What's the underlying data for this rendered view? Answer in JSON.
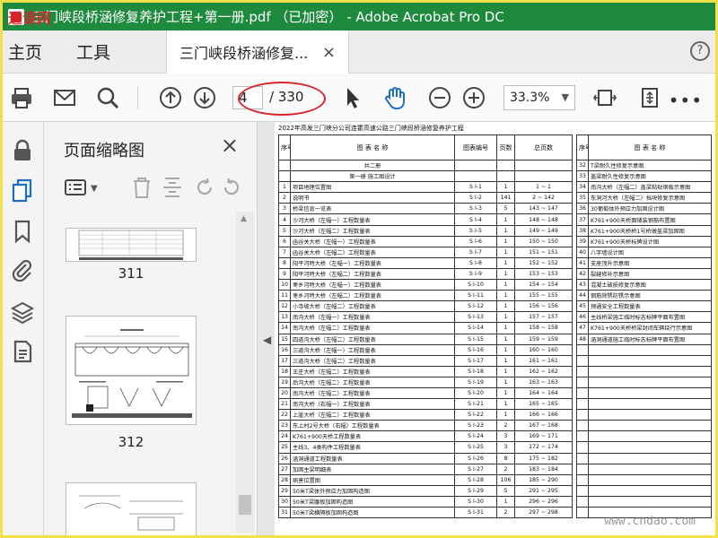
{
  "window": {
    "title": "三门峡段桥涵修复养护工程+第一册.pdf （已加密） - Adobe Acrobat Pro DC",
    "watermark_topleft": "进课网"
  },
  "menu": {
    "items": [
      "主页",
      "工具"
    ],
    "tab_label": "三门峡段桥涵修复...",
    "tab_close": "×",
    "help": "?"
  },
  "toolbar": {
    "current_page": "4",
    "total_pages": "/ 330",
    "zoom": "33.3%",
    "more": "•••"
  },
  "thumbnails": {
    "title": "页面缩略图",
    "close": "×",
    "pages": [
      "311",
      "312"
    ]
  },
  "document": {
    "header": "2022年高发三门峡分公司连霍高速公路三门峡段桥涵修复养护工程",
    "columns": {
      "seq": "序号",
      "name": "图 表 名 称",
      "code": "图表编号",
      "pages": "页数",
      "total": "总页数"
    },
    "left_rows": [
      [
        "",
        "共二册",
        "",
        "",
        ""
      ],
      [
        "",
        "第一册  施工图设计",
        "",
        "",
        ""
      ],
      [
        "1",
        "项目地理位置图",
        "S Ⅰ-1",
        "1",
        "1 ~ 1"
      ],
      [
        "2",
        "说明书",
        "S Ⅰ-2",
        "141",
        "2 ~ 142"
      ],
      [
        "3",
        "桥梁信息一览表",
        "S Ⅰ-3",
        "5",
        "143 ~ 147"
      ],
      [
        "4",
        "沙河大桥（左幅一）工程数量表",
        "S Ⅰ-4",
        "1",
        "148 ~ 148"
      ],
      [
        "5",
        "沙河大桥（左幅二）工程数量表",
        "S Ⅰ-5",
        "1",
        "149 ~ 149"
      ],
      [
        "6",
        "函谷关大桥（左幅一）工程数量表",
        "S Ⅰ-6",
        "1",
        "150 ~ 150"
      ],
      [
        "7",
        "函谷关大桥（左幅二）工程数量表",
        "S Ⅰ-7",
        "1",
        "151 ~ 151"
      ],
      [
        "8",
        "阳平河特大桥（左幅一）工程数量表",
        "S Ⅰ-8",
        "1",
        "152 ~ 152"
      ],
      [
        "9",
        "阳平河特大桥（左幅二）工程数量表",
        "S Ⅰ-9",
        "1",
        "153 ~ 153"
      ],
      [
        "10",
        "枣乡河特大桥（左幅一）工程数量表",
        "S Ⅰ-10",
        "1",
        "154 ~ 154"
      ],
      [
        "11",
        "枣乡河特大桥（左幅二）工程数量表",
        "S Ⅰ-11",
        "1",
        "155 ~ 155"
      ],
      [
        "12",
        "小寺坡大桥（左幅二）工程数量表",
        "S Ⅰ-12",
        "1",
        "156 ~ 156"
      ],
      [
        "13",
        "南沟大桥（左幅一）工程数量表",
        "S Ⅰ-13",
        "1",
        "157 ~ 157"
      ],
      [
        "14",
        "南沟大桥（左幅二）工程数量表",
        "S Ⅰ-14",
        "1",
        "158 ~ 158"
      ],
      [
        "15",
        "四道沟大桥（左幅二）工程数量表",
        "S Ⅰ-15",
        "1",
        "159 ~ 159"
      ],
      [
        "16",
        "三道沟大桥（左幅一）工程数量表",
        "S Ⅰ-16",
        "1",
        "160 ~ 160"
      ],
      [
        "17",
        "三道沟大桥（左幅二）工程数量表",
        "S Ⅰ-17",
        "1",
        "161 ~ 161"
      ],
      [
        "18",
        "王庄大桥（左幅二）工程数量表",
        "S Ⅰ-18",
        "1",
        "162 ~ 162"
      ],
      [
        "19",
        "后沟大桥（左幅二）工程数量表",
        "S Ⅰ-19",
        "1",
        "163 ~ 163"
      ],
      [
        "20",
        "南沟大桥（左幅二）工程数量表",
        "S Ⅰ-20",
        "1",
        "164 ~ 164"
      ],
      [
        "21",
        "南沟大桥（右幅一）工程数量表",
        "S Ⅰ-21",
        "1",
        "165 ~ 165"
      ],
      [
        "22",
        "上崖大桥（左幅二）工程数量表",
        "S Ⅰ-22",
        "1",
        "166 ~ 166"
      ],
      [
        "23",
        "东上村2号大桥（右幅）工程数量表",
        "S Ⅰ-23",
        "2",
        "167 ~ 168"
      ],
      [
        "24",
        "K761+900天桥工程数量表",
        "S Ⅰ-24",
        "3",
        "169 ~ 171"
      ],
      [
        "25",
        "主线3、4类构件工程数量表",
        "S Ⅰ-25",
        "3",
        "172 ~ 174"
      ],
      [
        "26",
        "涵洞通道工程数量表",
        "S Ⅰ-26",
        "8",
        "175 ~ 182"
      ],
      [
        "27",
        "加固主梁明细表",
        "S Ⅰ-27",
        "2",
        "183 ~ 184"
      ],
      [
        "28",
        "病害位置图",
        "S Ⅰ-28",
        "106",
        "185 ~ 290"
      ],
      [
        "29",
        "50米T梁体外预应力加固构造图",
        "S Ⅰ-29",
        "5",
        "291 ~ 295"
      ],
      [
        "30",
        "50米T梁腹板加固构造图",
        "S Ⅰ-30",
        "1",
        "296 ~ 296"
      ],
      [
        "31",
        "50米T梁横隔板加固构造图",
        "S Ⅰ-31",
        "2",
        "297 ~ 298"
      ]
    ],
    "right_rows": [
      [
        "32",
        "T梁耐久性修复示意图"
      ],
      [
        "33",
        "盖梁耐久性修复示意图"
      ],
      [
        "34",
        "南沟大桥（左幅二）盖梁粘贴钢板示意图"
      ],
      [
        "35",
        "东洞河大桥（左幅二）挡块修复示意图"
      ],
      [
        "36",
        "30葡萄体外预应力加固设计图"
      ],
      [
        "37",
        "K761+900天桥面铺装钢筋布置图"
      ],
      [
        "38",
        "K761+900天桥桥1号桥墩盖梁加固图"
      ],
      [
        "39",
        "K761+900天桥标牌设计图"
      ],
      [
        "40",
        "八字墙设计图"
      ],
      [
        "41",
        "支座顶升示意图"
      ],
      [
        "42",
        "裂缝修补示意图"
      ],
      [
        "43",
        "混凝土破损修复示意图"
      ],
      [
        "44",
        "钢筋除锈防锈示意图"
      ],
      [
        "45",
        "预通安全工程数量表"
      ],
      [
        "46",
        "主线桥梁施工临时标志标牌平面布置图"
      ],
      [
        "47",
        "K761+900天桥桥梁封闭车辆绕行示意图"
      ],
      [
        "48",
        "涵洞通道施工临时标志标牌平面布置图"
      ]
    ],
    "watermark": "www.cndao.com"
  },
  "colors": {
    "titlebar": "#1e8a3e",
    "frame_border": "#f2e04a",
    "annotation": "#d9232a",
    "icon_blue": "#1b6ec2"
  }
}
